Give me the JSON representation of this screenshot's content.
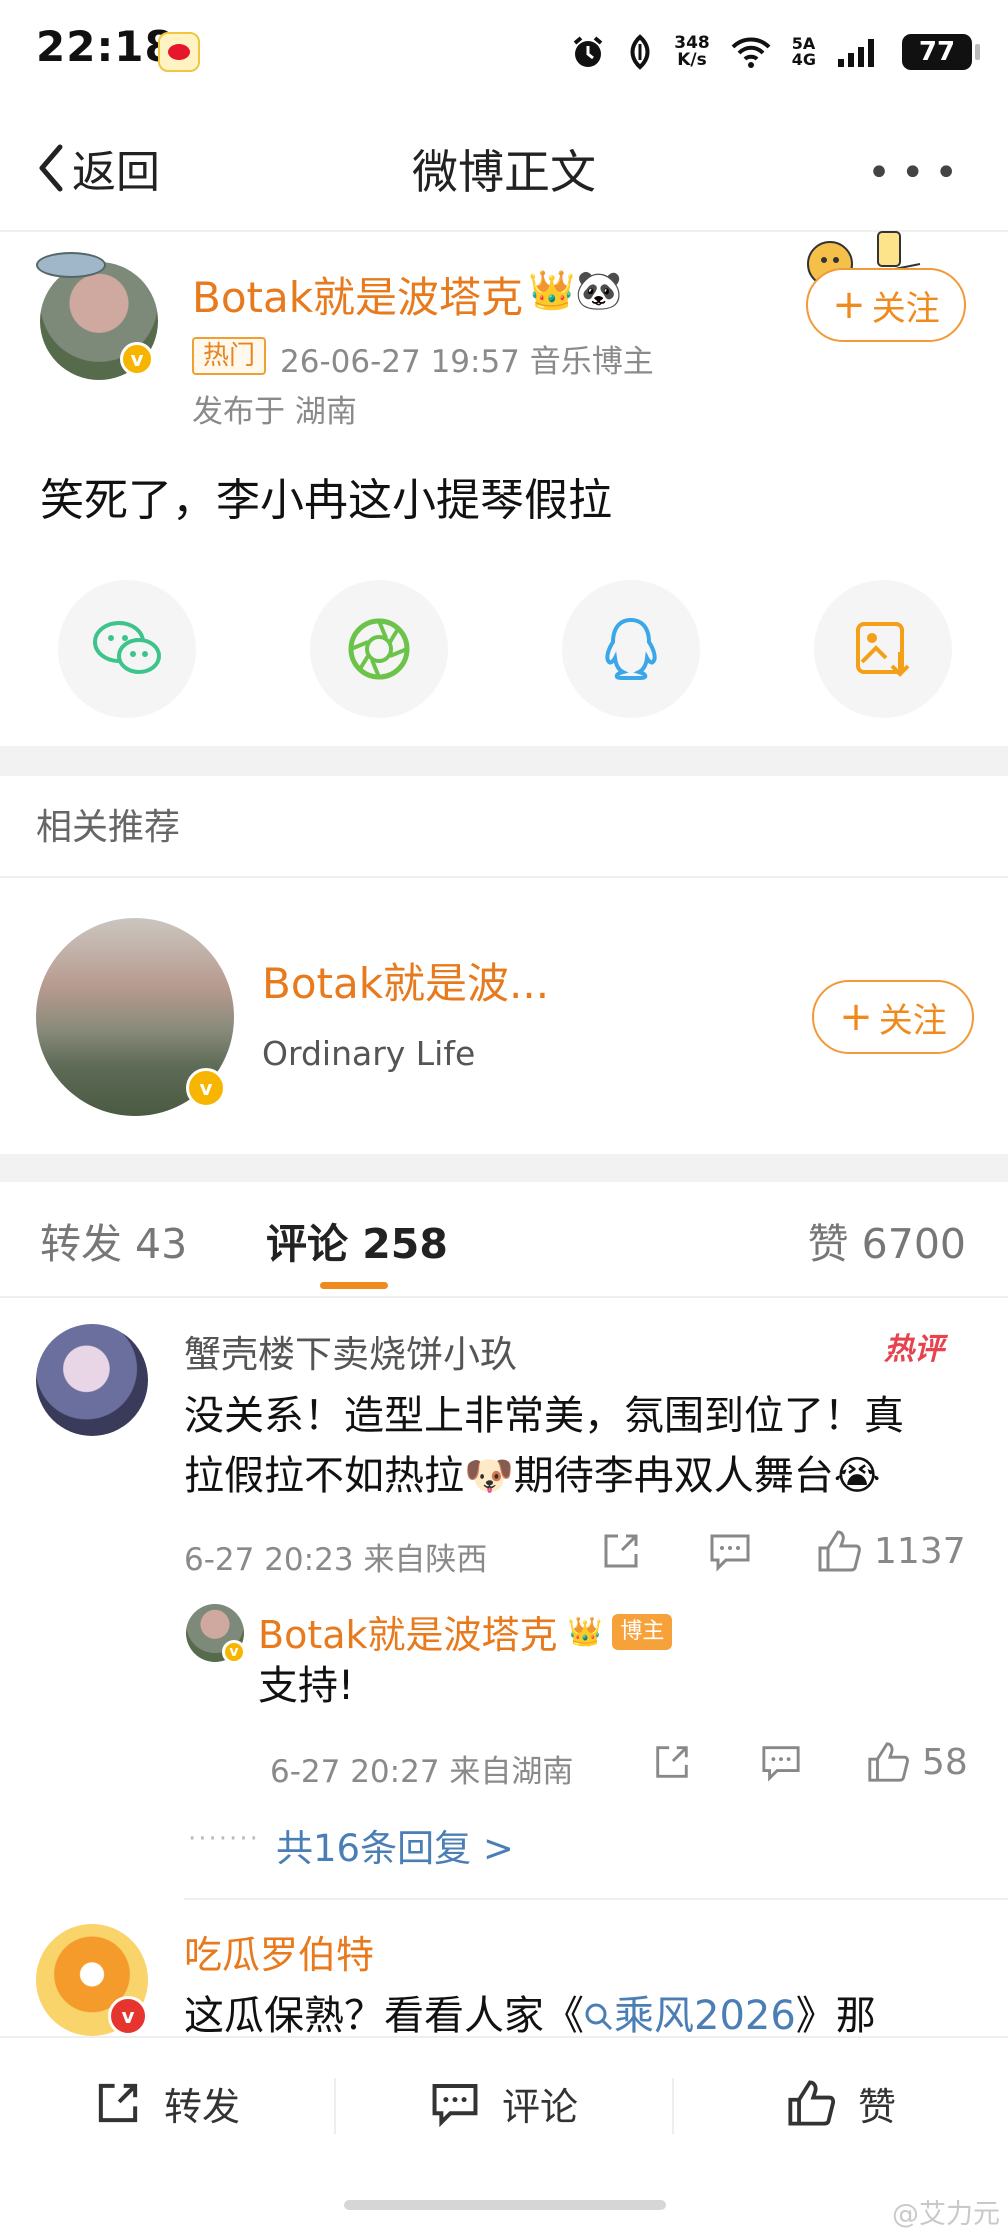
{
  "status_bar": {
    "time": "22:18",
    "net_speed_value": "348",
    "net_speed_unit": "K/s",
    "network_top": "5A",
    "network_bottom": "4G",
    "battery": "77"
  },
  "nav": {
    "back_label": "返回",
    "title": "微博正文"
  },
  "post": {
    "author_name": "Botak就是波塔克",
    "author_emojis": "👑🐼",
    "hot_tag": "热门",
    "meta": "26-06-27 19:57  音乐博主",
    "location": "发布于 湖南",
    "follow_label": "关注",
    "text": "笑死了，李小冉这小提琴假拉"
  },
  "share_icons": [
    "wechat-icon",
    "moments-icon",
    "qq-icon",
    "save-image-icon"
  ],
  "related": {
    "section_title": "相关推荐",
    "name": "Botak就是波...",
    "bio": "Ordinary Life",
    "follow_label": "关注"
  },
  "tabs": {
    "repost": "转发 43",
    "comment": "评论 258",
    "like": "赞 6700"
  },
  "comments": [
    {
      "name": "蟹壳楼下卖烧饼小玖",
      "hot_label": "热评",
      "text_line1": "没关系！造型上非常美，氛围到位了！真",
      "text_line2": "拉假拉不如热拉🐶期待李冉双人舞台😭",
      "meta": "6-27 20:23 来自陕西",
      "likes": "1137",
      "reply": {
        "name": "Botak就是波塔克",
        "tag": "博主",
        "text": "支持!",
        "meta": "6-27 20:27 来自湖南",
        "likes": "58"
      },
      "more_replies": "共16条回复 >"
    },
    {
      "name": "吃瓜罗伯特",
      "text_prefix": "这瓜保熟？看看人家《",
      "text_link": "乘风2026",
      "text_suffix": "》那"
    }
  ],
  "bottom_bar": {
    "repost": "转发",
    "comment": "评论",
    "like": "赞"
  },
  "watermark": "@艾力元"
}
